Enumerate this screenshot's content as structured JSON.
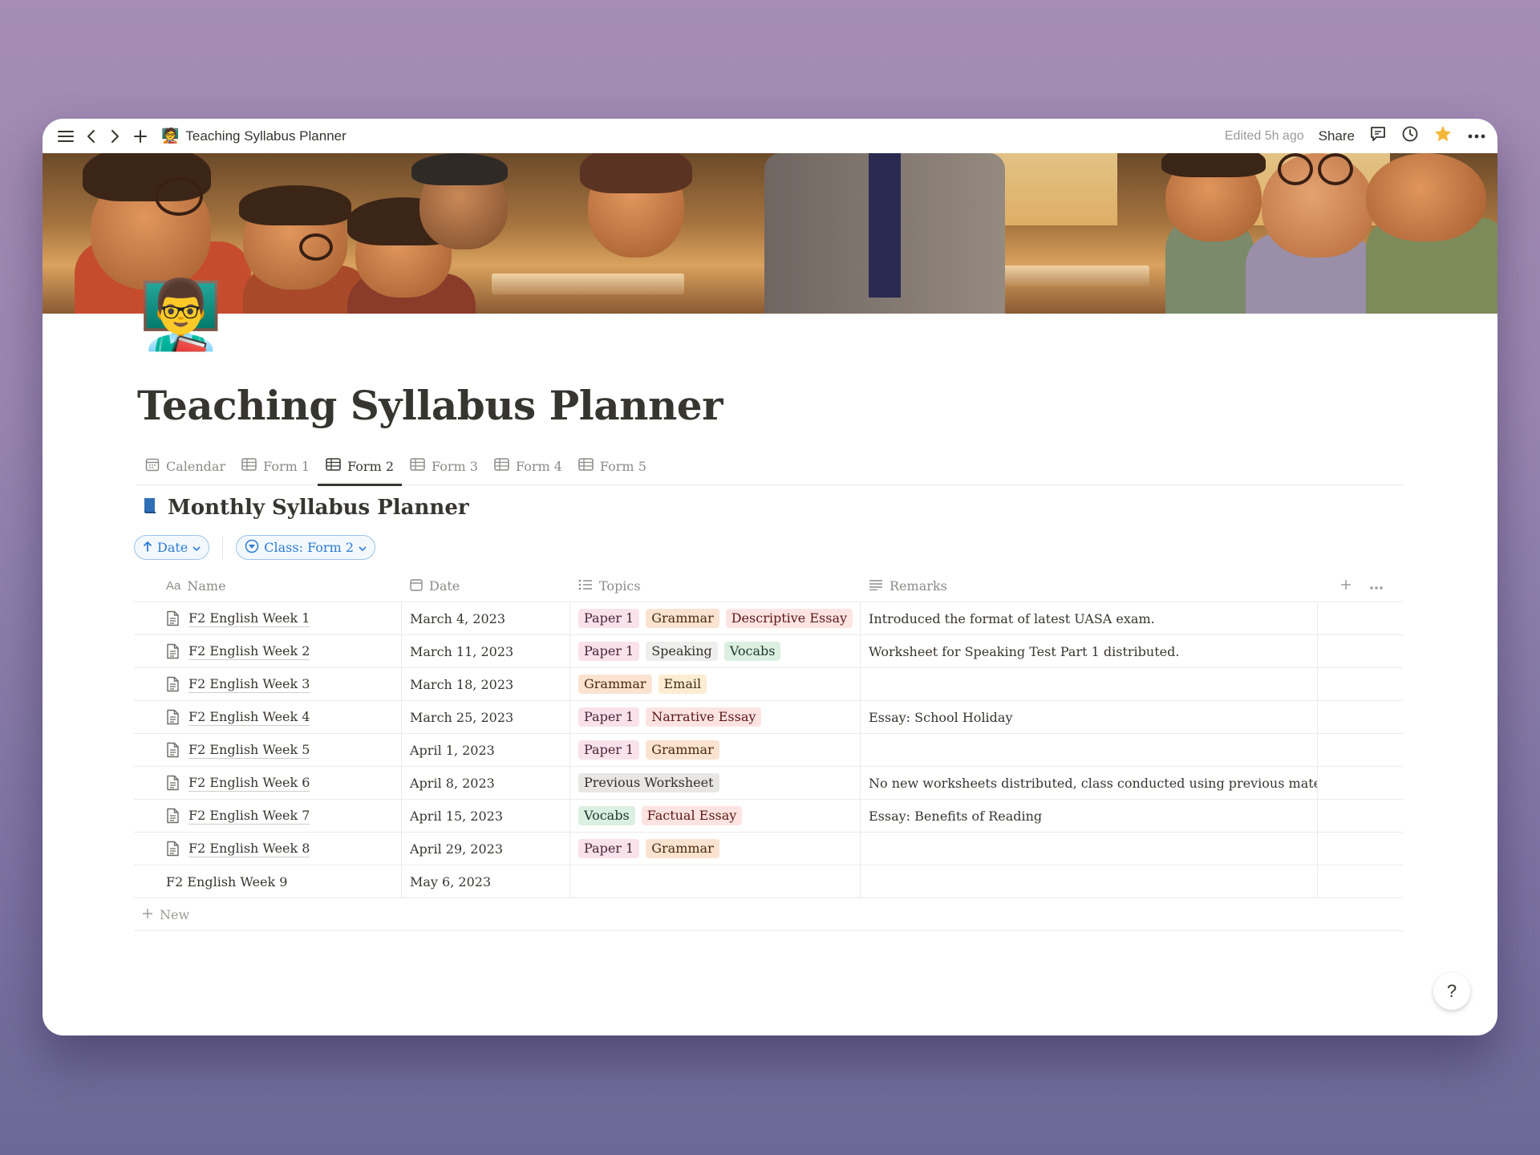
{
  "topbar": {
    "page_emoji": "🧑‍🏫",
    "breadcrumb": "Teaching Syllabus Planner",
    "edited": "Edited 5h ago",
    "share": "Share"
  },
  "page": {
    "icon_emoji": "👨‍🏫",
    "title": "Teaching Syllabus Planner"
  },
  "tabs": [
    {
      "label": "Calendar",
      "icon": "calendar-icon"
    },
    {
      "label": "Form 1",
      "icon": "table-icon"
    },
    {
      "label": "Form 2",
      "icon": "table-icon",
      "active": true
    },
    {
      "label": "Form 3",
      "icon": "table-icon"
    },
    {
      "label": "Form 4",
      "icon": "table-icon"
    },
    {
      "label": "Form 5",
      "icon": "table-icon"
    }
  ],
  "database": {
    "title": "Monthly Syllabus Planner",
    "sort_label": "Date",
    "filter_label": "Class: Form 2"
  },
  "columns": {
    "name": "Name",
    "name_icon": "Aa",
    "date": "Date",
    "topics": "Topics",
    "remarks": "Remarks"
  },
  "tag_colors": {
    "Paper 1": {
      "bg": "#f9e2ea",
      "fg": "#4c2337"
    },
    "Grammar": {
      "bg": "#fbe3d1",
      "fg": "#49290e"
    },
    "Descriptive Essay": {
      "bg": "#fde4e2",
      "fg": "#5d1715"
    },
    "Speaking": {
      "bg": "#eeeeed",
      "fg": "#32302c"
    },
    "Vocabs": {
      "bg": "#dcf0e2",
      "fg": "#1c3829"
    },
    "Email": {
      "bg": "#fcecd2",
      "fg": "#402c1b"
    },
    "Narrative Essay": {
      "bg": "#fde4e2",
      "fg": "#5d1715"
    },
    "Previous Worksheet": {
      "bg": "#e8e7e4",
      "fg": "#32302c"
    },
    "Factual Essay": {
      "bg": "#fde4e2",
      "fg": "#5d1715"
    }
  },
  "rows": [
    {
      "name": "F2 English Week 1",
      "date": "March 4, 2023",
      "topics": [
        "Paper 1",
        "Grammar",
        "Descriptive Essay"
      ],
      "remarks": "Introduced the format of latest UASA exam.",
      "has_icon": true
    },
    {
      "name": "F2 English Week 2",
      "date": "March 11, 2023",
      "topics": [
        "Paper 1",
        "Speaking",
        "Vocabs"
      ],
      "remarks": "Worksheet for Speaking Test Part 1 distributed.",
      "has_icon": true
    },
    {
      "name": "F2 English Week 3",
      "date": "March 18, 2023",
      "topics": [
        "Grammar",
        "Email"
      ],
      "remarks": "",
      "has_icon": true
    },
    {
      "name": "F2 English Week 4",
      "date": "March 25, 2023",
      "topics": [
        "Paper 1",
        "Narrative Essay"
      ],
      "remarks": "Essay: School Holiday",
      "has_icon": true
    },
    {
      "name": "F2 English Week 5",
      "date": "April 1, 2023",
      "topics": [
        "Paper 1",
        "Grammar"
      ],
      "remarks": "",
      "has_icon": true
    },
    {
      "name": "F2 English Week 6",
      "date": "April 8, 2023",
      "topics": [
        "Previous Worksheet"
      ],
      "remarks": "No new worksheets distributed, class conducted using previous materials.",
      "has_icon": true
    },
    {
      "name": "F2 English Week 7",
      "date": "April 15, 2023",
      "topics": [
        "Vocabs",
        "Factual Essay"
      ],
      "remarks": "Essay: Benefits of Reading",
      "has_icon": true
    },
    {
      "name": "F2 English Week 8",
      "date": "April 29, 2023",
      "topics": [
        "Paper 1",
        "Grammar"
      ],
      "remarks": "",
      "has_icon": true
    },
    {
      "name": "F2 English Week 9",
      "date": "May 6, 2023",
      "topics": [],
      "remarks": "",
      "has_icon": false
    }
  ],
  "new_row_label": "New",
  "help_label": "?"
}
